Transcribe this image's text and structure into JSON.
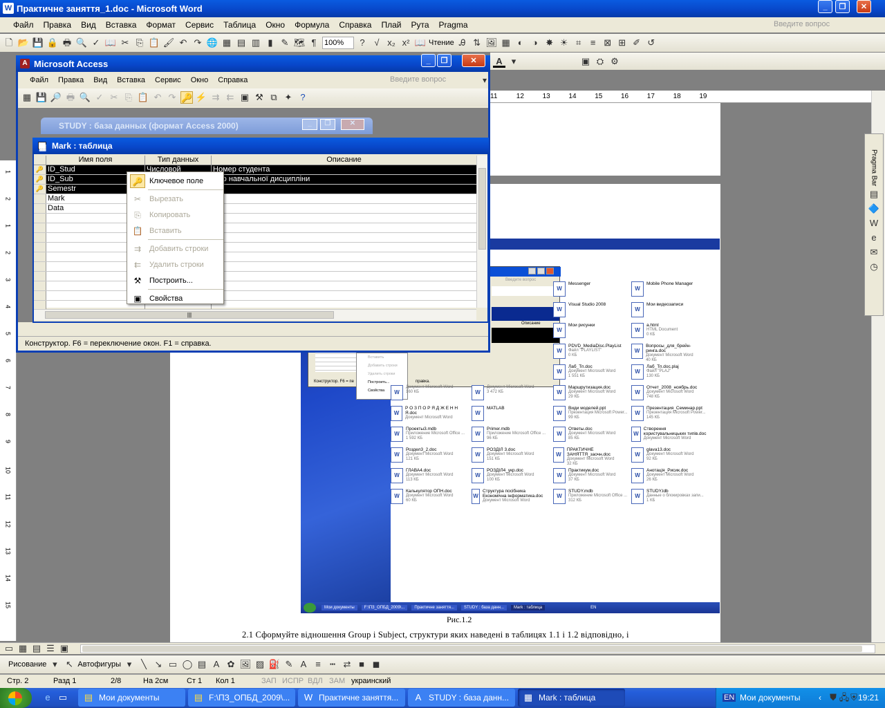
{
  "word": {
    "title": "Практичне заняття_1.doc - Microsoft Word",
    "menu": [
      "Файл",
      "Правка",
      "Вид",
      "Вставка",
      "Формат",
      "Сервис",
      "Таблица",
      "Окно",
      "Формула",
      "Справка",
      "Плай",
      "Рута",
      "Pragma"
    ],
    "ask_placeholder": "Введите вопрос",
    "zoom": "100%",
    "reading": "Чтение",
    "ruler_right": [
      "11",
      "12",
      "13",
      "14",
      "15",
      "16",
      "17",
      "18",
      "19"
    ],
    "ruler_left": [
      "1",
      "2",
      "1",
      "2",
      "3",
      "4",
      "5",
      "6",
      "7",
      "8",
      "9",
      "10",
      "11",
      "12",
      "13",
      "14",
      "15"
    ],
    "caption": "Рис.1.2",
    "body_text": "2.1  Сформуйте відношення Group і Subject, структури яких наведені в таблицях 1.1 і 1.2 відповідно, і",
    "drawing": {
      "label": "Рисование",
      "autoshapes": "Автофигуры"
    },
    "status": {
      "page": "Стр. 2",
      "section": "Разд 1",
      "pages": "2/8",
      "at": "На 2см",
      "line": "Ст 1",
      "col": "Кол 1",
      "rec": "ЗАП",
      "trk": "ИСПР",
      "ext": "ВДЛ",
      "ovr": "ЗАМ",
      "lang": "украинский"
    },
    "pragma_bar": "Pragma Bar"
  },
  "access": {
    "title": "Microsoft Access",
    "menu": [
      "Файл",
      "Правка",
      "Вид",
      "Вставка",
      "Сервис",
      "Окно",
      "Справка"
    ],
    "ask_placeholder": "Введите вопрос",
    "db_title": "STUDY : база данных (формат Access 2000)",
    "table_title": "Mark : таблица",
    "columns": [
      "Имя поля",
      "Тип данных",
      "Описание"
    ],
    "rows": [
      {
        "name": "ID_Stud",
        "type": "Числовой",
        "desc": "Номер студента",
        "key": true,
        "sel": true
      },
      {
        "name": "ID_Sub",
        "type": "",
        "desc": "мер навчальної дисципліни",
        "key": true,
        "sel": true
      },
      {
        "name": "Semestr",
        "type": "",
        "desc": "",
        "key": true,
        "sel": true
      },
      {
        "name": "Mark",
        "type": "",
        "desc": "",
        "key": false,
        "sel": false
      },
      {
        "name": "Data",
        "type": "",
        "desc": "",
        "key": false,
        "sel": false
      }
    ],
    "status": "Конструктор.  F6 = переключение окон.  F1 = справка."
  },
  "context_menu": [
    {
      "label": "Ключевое поле",
      "icon": "key-icon",
      "enabled": true
    },
    {
      "label": "Вырезать",
      "icon": "scissors-icon",
      "enabled": false
    },
    {
      "label": "Копировать",
      "icon": "copy-icon",
      "enabled": false
    },
    {
      "label": "Вставить",
      "icon": "paste-icon",
      "enabled": false
    },
    {
      "label": "Добавить строки",
      "icon": "insert-rows-icon",
      "enabled": false
    },
    {
      "label": "Удалить строки",
      "icon": "delete-rows-icon",
      "enabled": false
    },
    {
      "label": "Построить...",
      "icon": "build-icon",
      "enabled": true
    },
    {
      "label": "Свойства",
      "icon": "properties-icon",
      "enabled": true
    }
  ],
  "embedded": {
    "ask": "Введите вопрос",
    "col": "Описание",
    "status": "Конструктор.  F6 = пе",
    "status_tail": "правка.",
    "ctx": [
      "Вставить",
      "Добавить строки",
      "Удалить строки",
      "Построить...",
      "Свойства"
    ],
    "files": [
      {
        "n": "Messenger",
        "d": "",
        "s": ""
      },
      {
        "n": "Mobile Phone Manager",
        "d": "",
        "s": ""
      },
      {
        "n": "Visual Studio 2008",
        "d": "",
        "s": ""
      },
      {
        "n": "Мои видеозаписи",
        "d": "",
        "s": ""
      },
      {
        "n": "Мои рисунки",
        "d": "",
        "s": ""
      },
      {
        "n": "a.html",
        "d": "HTML Document",
        "s": "0 КБ"
      },
      {
        "n": "PDVD_MediaDisc.PlayList",
        "d": "Файл \"PLAYLIST\"",
        "s": "0 КБ"
      },
      {
        "n": "Вопросы_для_брейн-ринга.doc",
        "d": "Документ Microsoft Word",
        "s": "40 КБ"
      },
      {
        "n": "Лаб_Тп.doc",
        "d": "Документ Microsoft Word",
        "s": "1 551 КБ"
      },
      {
        "n": "Лаб_Тп.doc.plaj",
        "d": "Файл \"PLAJ\"",
        "s": "130 КБ"
      },
      {
        "n": "Маршрутизация.doc",
        "d": "Документ Microsoft Word",
        "s": "29 КБ"
      },
      {
        "n": "Отчет_2008_ноябрь.doc",
        "d": "Документ Microsoft Word",
        "s": "748 КБ"
      },
      {
        "n": "Види моделей.ppt",
        "d": "Презентация Microsoft Power...",
        "s": "99 КБ"
      },
      {
        "n": "Презентация_Семинар.ppt",
        "d": "Презентация Microsoft Power...",
        "s": "145 КБ"
      },
      {
        "n": "Ответы.doc",
        "d": "Документ Microsoft Word",
        "s": "85 КБ"
      },
      {
        "n": "Створення користувальницьких типів.doc",
        "d": "Документ Microsoft Word",
        "s": ""
      },
      {
        "n": "ПРАКТИЧНЕ ЗАНЯТТЯ_заочн.doc",
        "d": "Документ Microsoft Word",
        "s": "32 КБ"
      },
      {
        "n": "glava13.doc",
        "d": "Документ Microsoft Word",
        "s": "92 КБ"
      },
      {
        "n": "Практикум.doc",
        "d": "Документ Microsoft Word",
        "s": "37 КБ"
      },
      {
        "n": "Анотація_Рисик.doc",
        "d": "Документ Microsoft Word",
        "s": "26 КБ"
      },
      {
        "n": "STUDY.mdb",
        "d": "Приложение Microsoft Office ...",
        "s": "312 КБ"
      },
      {
        "n": "STUDY.ldb",
        "d": "Данные о блокировках запи...",
        "s": "1 КБ"
      }
    ],
    "files_left": [
      {
        "n": "",
        "d": "Документ Microsoft Word",
        "s": "160 КБ"
      },
      {
        "n": "",
        "d": "Документ Microsoft Word",
        "s": "3 472 КБ"
      },
      {
        "n": "Р О З П О Р Я Д Ж Е Н Н Я.doc",
        "d": "Документ Microsoft Word",
        "s": ""
      },
      {
        "n": "MATLAB",
        "d": "",
        "s": ""
      },
      {
        "n": "Проекты3.mdb",
        "d": "Приложение Microsoft Office ...",
        "s": "1 592 КБ"
      },
      {
        "n": "Primer.mdb",
        "d": "Приложение Microsoft Office ...",
        "s": "96 КБ"
      },
      {
        "n": "Роздел3_2.doc",
        "d": "Документ Microsoft Word",
        "s": "121 КБ"
      },
      {
        "n": "РОЗДІЛ 3.doc",
        "d": "Документ Microsoft Word",
        "s": "151 КБ"
      },
      {
        "n": "ГЛАВА4.doc",
        "d": "Документ Microsoft Word",
        "s": "113 КБ"
      },
      {
        "n": "РОЗДІЛ4_укр.doc",
        "d": "Документ Microsoft Word",
        "s": "100 КБ"
      },
      {
        "n": "Калькулятор ОПН.doc",
        "d": "Документ Microsoft Word",
        "s": "60 КБ"
      },
      {
        "n": "Структура посібника Економічна інформатика.doc",
        "d": "Документ Microsoft Word",
        "s": ""
      }
    ],
    "taskbar": [
      "Мои документы",
      "F:\\ПЗ_ОПБД_2009\\...",
      "Практичне заняття...",
      "STUDY : база данн...",
      "Mark : таблица"
    ],
    "lang": "EN"
  },
  "taskbar": {
    "items": [
      "Мои документы",
      "F:\\ПЗ_ОПБД_2009\\...",
      "Практичне заняття...",
      "STUDY : база данн...",
      "Mark : таблица"
    ],
    "lang": "EN",
    "tray_label": "Мои документы",
    "time": "19:21"
  }
}
